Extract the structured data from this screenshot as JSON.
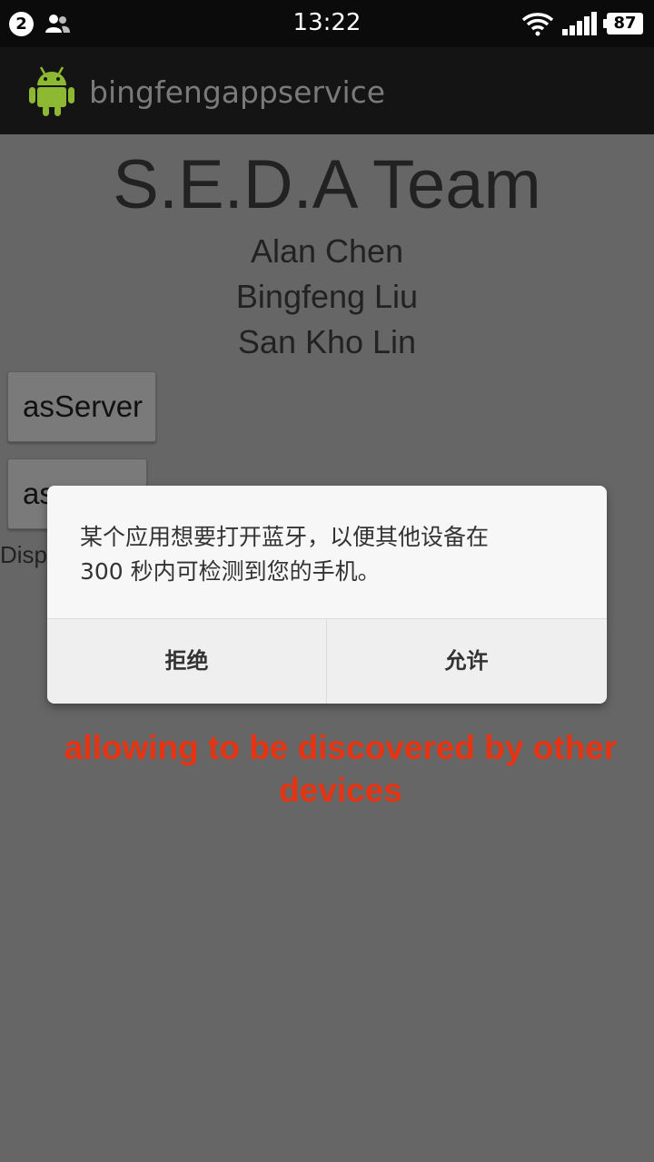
{
  "status_bar": {
    "notification_count": "2",
    "time": "13:22",
    "battery": "87"
  },
  "action_bar": {
    "app_title": "bingfengappservice"
  },
  "main": {
    "team_title": "S.E.D.A Team",
    "members": [
      "Alan Chen",
      "Bingfeng Liu",
      "San Kho Lin"
    ],
    "server_button": "asServer",
    "client_button_visible": "as",
    "display_label_visible": "Disp"
  },
  "dialog": {
    "message_line1": "某个应用想要打开蓝牙，以便其他设备在",
    "message_line2": "300 秒内可检测到您的手机。",
    "deny_label": "拒绝",
    "allow_label": "允许"
  },
  "annotation": {
    "line1": "allowing to be discovered by other",
    "line2": "devices",
    "color": "#e63312"
  },
  "colors": {
    "overlay_background": "#666666",
    "status_bar": "#0b0b0b",
    "action_bar": "#141414",
    "android_green": "#8cb832"
  }
}
